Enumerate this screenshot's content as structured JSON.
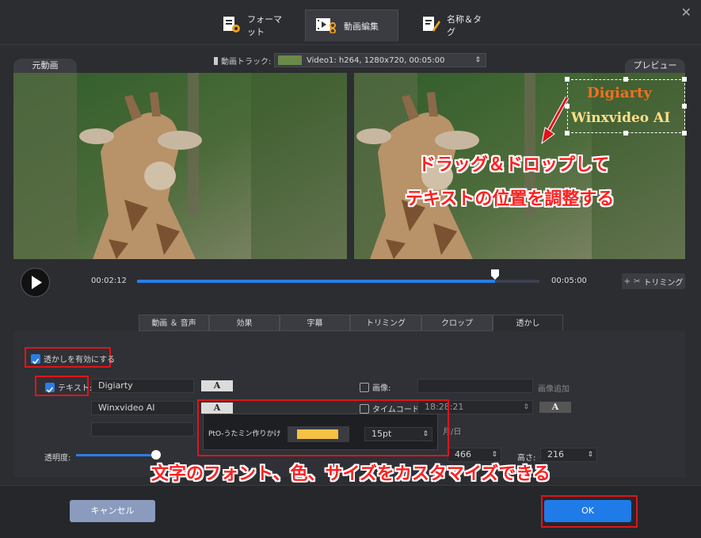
{
  "tabs": [
    {
      "label": "フォーマット"
    },
    {
      "label": "動画編集"
    },
    {
      "label": "名称＆タグ"
    }
  ],
  "track": {
    "label": "動画トラック:",
    "value": "Video1: h264, 1280x720, 00:05:00"
  },
  "original_label": "元動画",
  "preview_label": "プレビュー",
  "watermark_preview": {
    "line1": "Digiarty",
    "line2": "Winxvideo AI"
  },
  "annotation_drag": {
    "line1": "ドラッグ＆ドロップして",
    "line2": "テキストの位置を調整する"
  },
  "annotation_font": "文字のフォント、色、サイズをカスタマイズできる",
  "playback": {
    "current": "00:02:12",
    "total": "00:05:00",
    "progress": 0.89
  },
  "trim_button": "トリミング",
  "subtabs": [
    {
      "label": "動画 ＆ 音声"
    },
    {
      "label": "効果"
    },
    {
      "label": "字幕"
    },
    {
      "label": "トリミング"
    },
    {
      "label": "クロップ"
    },
    {
      "label": "透かし"
    }
  ],
  "watermark": {
    "enable_label": "透かしを有効にする",
    "text_label": "テキスト:",
    "text1": "Digiarty",
    "text2": "Winxvideo AI",
    "a_glyph": "A",
    "image_label": "画像:",
    "add_image": "画像追加",
    "timecode_label": "タイムコード:",
    "timecode_value": "18:28:21",
    "date_suffix": "月/日",
    "opacity_label": "透明度:",
    "opacity": 0.97,
    "width_value": "466",
    "height_label": "高さ:",
    "height_value": "216"
  },
  "font_popup": {
    "font": "PtO-うたミン作りかけ",
    "color": "#f6c244",
    "size": "15pt"
  },
  "footer": {
    "cancel": "キャンセル",
    "ok": "OK"
  },
  "colors": {
    "accent": "#1f7be8",
    "highlight": "#e0141b"
  }
}
